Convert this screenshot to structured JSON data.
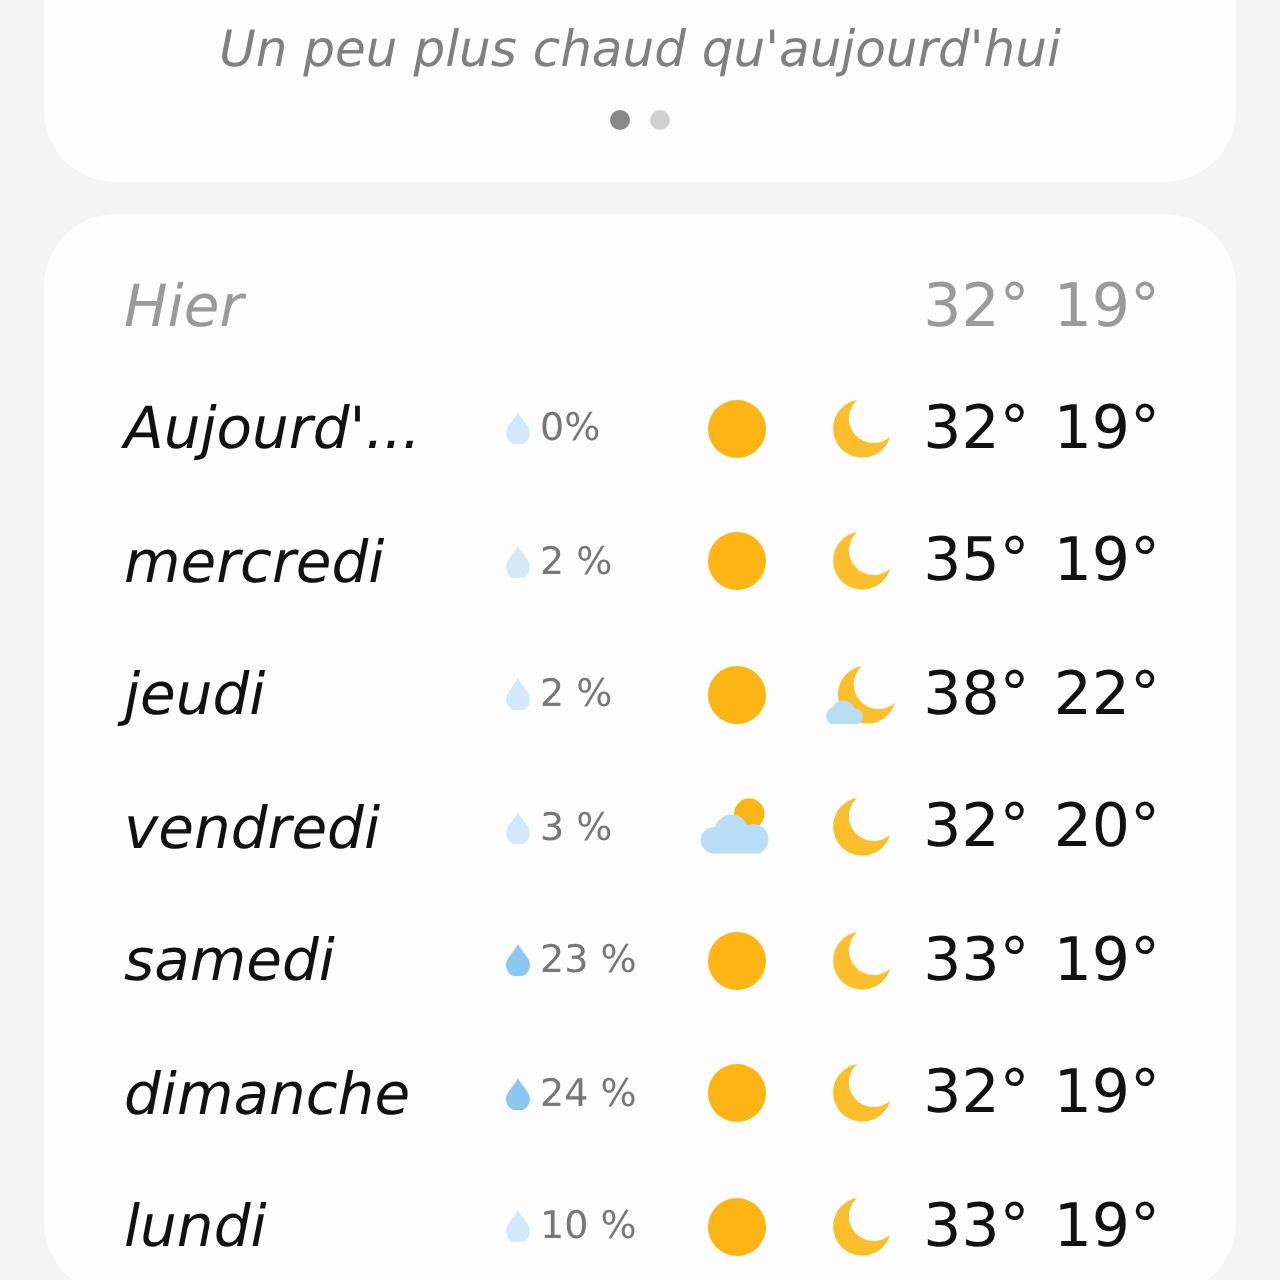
{
  "summary": {
    "text": "Un peu plus chaud qu'aujourd'hui",
    "pages": [
      {
        "selected": true
      },
      {
        "selected": false
      }
    ]
  },
  "forecast": {
    "yesterday": {
      "label": "Hier",
      "high": "32°",
      "low": "19°"
    },
    "days": [
      {
        "name": "Aujourd'...",
        "rain": "0%",
        "rain_likely": false,
        "day": {
          "kind": "sun"
        },
        "night": {
          "kind": "moon"
        },
        "high": "32°",
        "low": "19°"
      },
      {
        "name": "mercredi",
        "rain": "2 %",
        "rain_likely": false,
        "day": {
          "kind": "sun"
        },
        "night": {
          "kind": "moon"
        },
        "high": "35°",
        "low": "19°"
      },
      {
        "name": "jeudi",
        "rain": "2 %",
        "rain_likely": false,
        "day": {
          "kind": "sun"
        },
        "night": {
          "kind": "moon-cloud"
        },
        "high": "38°",
        "low": "22°"
      },
      {
        "name": "vendredi",
        "rain": "3 %",
        "rain_likely": false,
        "day": {
          "kind": "sun-cloud"
        },
        "night": {
          "kind": "moon"
        },
        "high": "32°",
        "low": "20°"
      },
      {
        "name": "samedi",
        "rain": "23 %",
        "rain_likely": true,
        "day": {
          "kind": "sun"
        },
        "night": {
          "kind": "moon"
        },
        "high": "33°",
        "low": "19°"
      },
      {
        "name": "dimanche",
        "rain": "24 %",
        "rain_likely": true,
        "day": {
          "kind": "sun"
        },
        "night": {
          "kind": "moon"
        },
        "high": "32°",
        "low": "19°"
      },
      {
        "name": "lundi",
        "rain": "10 %",
        "rain_likely": false,
        "day": {
          "kind": "sun"
        },
        "night": {
          "kind": "moon"
        },
        "high": "33°",
        "low": "19°"
      }
    ]
  }
}
